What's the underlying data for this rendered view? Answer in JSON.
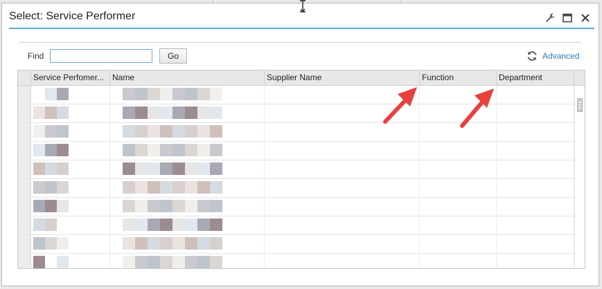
{
  "dialog": {
    "title": "Select: Service Performer"
  },
  "toolbar": {
    "find_label": "Find",
    "find_value": "",
    "go_label": "Go",
    "advanced_label": "Advanced"
  },
  "table": {
    "columns": [
      "Service Perfomer...",
      "Name",
      "Supplier Name",
      "Function",
      "Department"
    ],
    "row_count": 10
  },
  "colors": {
    "accent": "#5aa9d6",
    "link": "#2c7bb6",
    "annotation_arrow": "#e8403c"
  }
}
